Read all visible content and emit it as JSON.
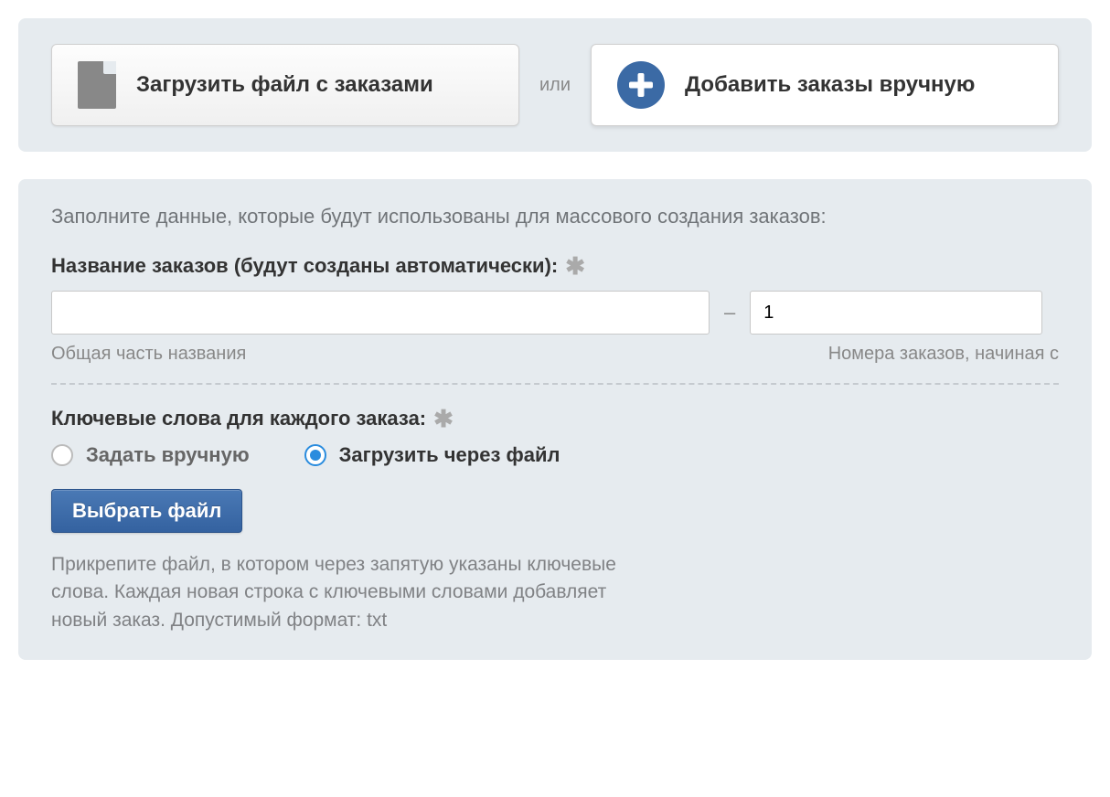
{
  "topTabs": {
    "upload": {
      "label": "Загрузить файл с заказами"
    },
    "or": "или",
    "manual": {
      "label": "Добавить заказы вручную"
    }
  },
  "form": {
    "instruction": "Заполните данные, которые будут использованы для массового создания заказов:",
    "orderName": {
      "label": "Название заказов (будут созданы автоматически):",
      "commonPart": {
        "value": "",
        "hint": "Общая часть названия"
      },
      "startNumber": {
        "value": "1",
        "hint": "Номера заказов, начиная с"
      }
    },
    "keywords": {
      "label": "Ключевые слова для каждого заказа:",
      "options": {
        "manual": {
          "label": "Задать вручную",
          "checked": false
        },
        "file": {
          "label": "Загрузить через файл",
          "checked": true
        }
      },
      "chooseFileButton": "Выбрать файл",
      "helpText": "Прикрепите файл, в котором через запятую указаны ключевые слова. Каждая новая строка с ключевыми словами добавляет новый заказ. Допустимый формат: txt"
    }
  }
}
